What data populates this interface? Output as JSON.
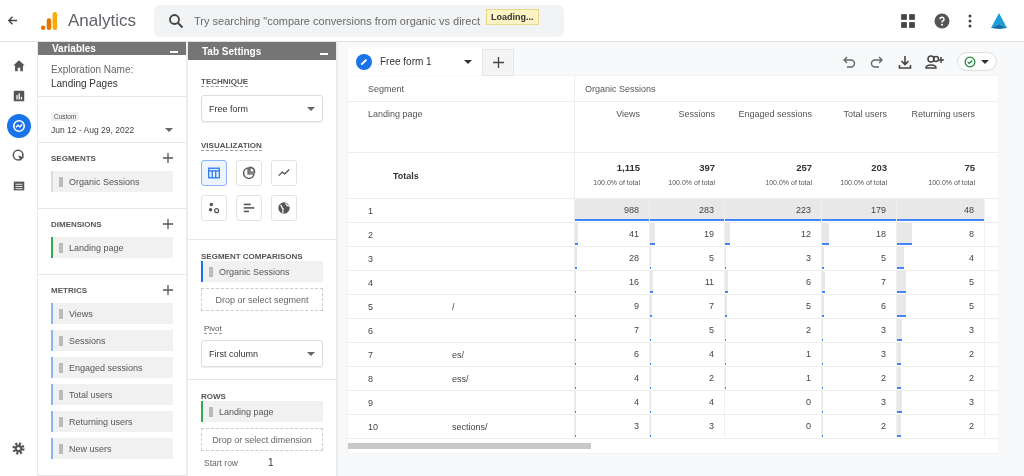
{
  "top_bar": {
    "app_name": "Analytics",
    "search_placeholder": "Try searching \"compare conversions from organic vs direct",
    "loading_tooltip": "Loading..."
  },
  "nav_rail": [
    {
      "kind": "home",
      "selected": false
    },
    {
      "kind": "reports",
      "selected": false
    },
    {
      "kind": "explore",
      "selected": true
    },
    {
      "kind": "advertising",
      "selected": false
    },
    {
      "kind": "list",
      "selected": false
    }
  ],
  "variables": {
    "title": "Variables",
    "exploration_label": "Exploration Name:",
    "exploration_name": "Landing Pages",
    "date_badge": "Custom",
    "date_range": "Jun 12 - Aug 29, 2022",
    "sections": [
      {
        "heading": "SEGMENTS",
        "items": [
          {
            "label": "Organic Sessions",
            "color": "#dadce0"
          }
        ]
      },
      {
        "heading": "DIMENSIONS",
        "items": [
          {
            "label": "Landing page",
            "color": "#34a853"
          }
        ]
      },
      {
        "heading": "METRICS",
        "items": [
          {
            "label": "Views",
            "color": "#8ab4f8"
          },
          {
            "label": "Sessions",
            "color": "#8ab4f8"
          },
          {
            "label": "Engaged sessions",
            "color": "#8ab4f8"
          },
          {
            "label": "Total users",
            "color": "#8ab4f8"
          },
          {
            "label": "Returning users",
            "color": "#8ab4f8"
          },
          {
            "label": "New users",
            "color": "#8ab4f8"
          }
        ]
      }
    ]
  },
  "tab_settings": {
    "title": "Tab Settings",
    "technique_label": "TECHNIQUE",
    "technique_value": "Free form",
    "visualization_label": "VISUALIZATION",
    "visualizations": [
      {
        "kind": "table",
        "selected": true
      },
      {
        "kind": "donut",
        "selected": false
      },
      {
        "kind": "line",
        "selected": false
      },
      {
        "kind": "scatter",
        "selected": false
      },
      {
        "kind": "bar",
        "selected": false
      },
      {
        "kind": "geo",
        "selected": false
      }
    ],
    "segment_comparisons_label": "SEGMENT COMPARISONS",
    "segment_chip": "Organic Sessions",
    "segment_drop": "Drop or select segment",
    "pivot_label": "Pivot",
    "pivot_value": "First column",
    "rows_label": "ROWS",
    "rows_chip": "Landing page",
    "rows_drop": "Drop or select dimension",
    "start_row_label": "Start row",
    "start_row_value": "1"
  },
  "canvas": {
    "tabs": [
      {
        "label": "Free form 1",
        "selected": true
      }
    ],
    "table": {
      "segment_header": "Segment",
      "segment_name": "Organic Sessions",
      "dimension_header": "Landing page",
      "columns": [
        "Views",
        "Sessions",
        "Engaged sessions",
        "Total users",
        "Returning users"
      ],
      "totals_label": "Totals",
      "totals": [
        {
          "value": "1,115",
          "share": "100.0% of total"
        },
        {
          "value": "397",
          "share": "100.0% of total"
        },
        {
          "value": "257",
          "share": "100.0% of total"
        },
        {
          "value": "203",
          "share": "100.0% of total"
        },
        {
          "value": "75",
          "share": "100.0% of total"
        }
      ],
      "rows": [
        {
          "index": "1",
          "values": [
            "988",
            "283",
            "223",
            "179",
            "48"
          ]
        },
        {
          "index": "2",
          "values": [
            "41",
            "19",
            "12",
            "18",
            "8"
          ]
        },
        {
          "index": "3",
          "values": [
            "28",
            "5",
            "3",
            "5",
            "4"
          ]
        },
        {
          "index": "4",
          "values": [
            "16",
            "11",
            "6",
            "7",
            "5"
          ]
        },
        {
          "index": "5",
          "page": "/",
          "values": [
            "9",
            "7",
            "5",
            "6",
            "5"
          ]
        },
        {
          "index": "6",
          "values": [
            "7",
            "5",
            "2",
            "3",
            "3"
          ]
        },
        {
          "index": "7",
          "page": "es/",
          "values": [
            "6",
            "4",
            "1",
            "3",
            "2"
          ]
        },
        {
          "index": "8",
          "page": "ess/",
          "values": [
            "4",
            "2",
            "1",
            "2",
            "2"
          ]
        },
        {
          "index": "9",
          "values": [
            "4",
            "4",
            "0",
            "3",
            "3"
          ]
        },
        {
          "index": "10",
          "page": "sections/",
          "values": [
            "3",
            "3",
            "0",
            "2",
            "2"
          ]
        }
      ]
    }
  }
}
